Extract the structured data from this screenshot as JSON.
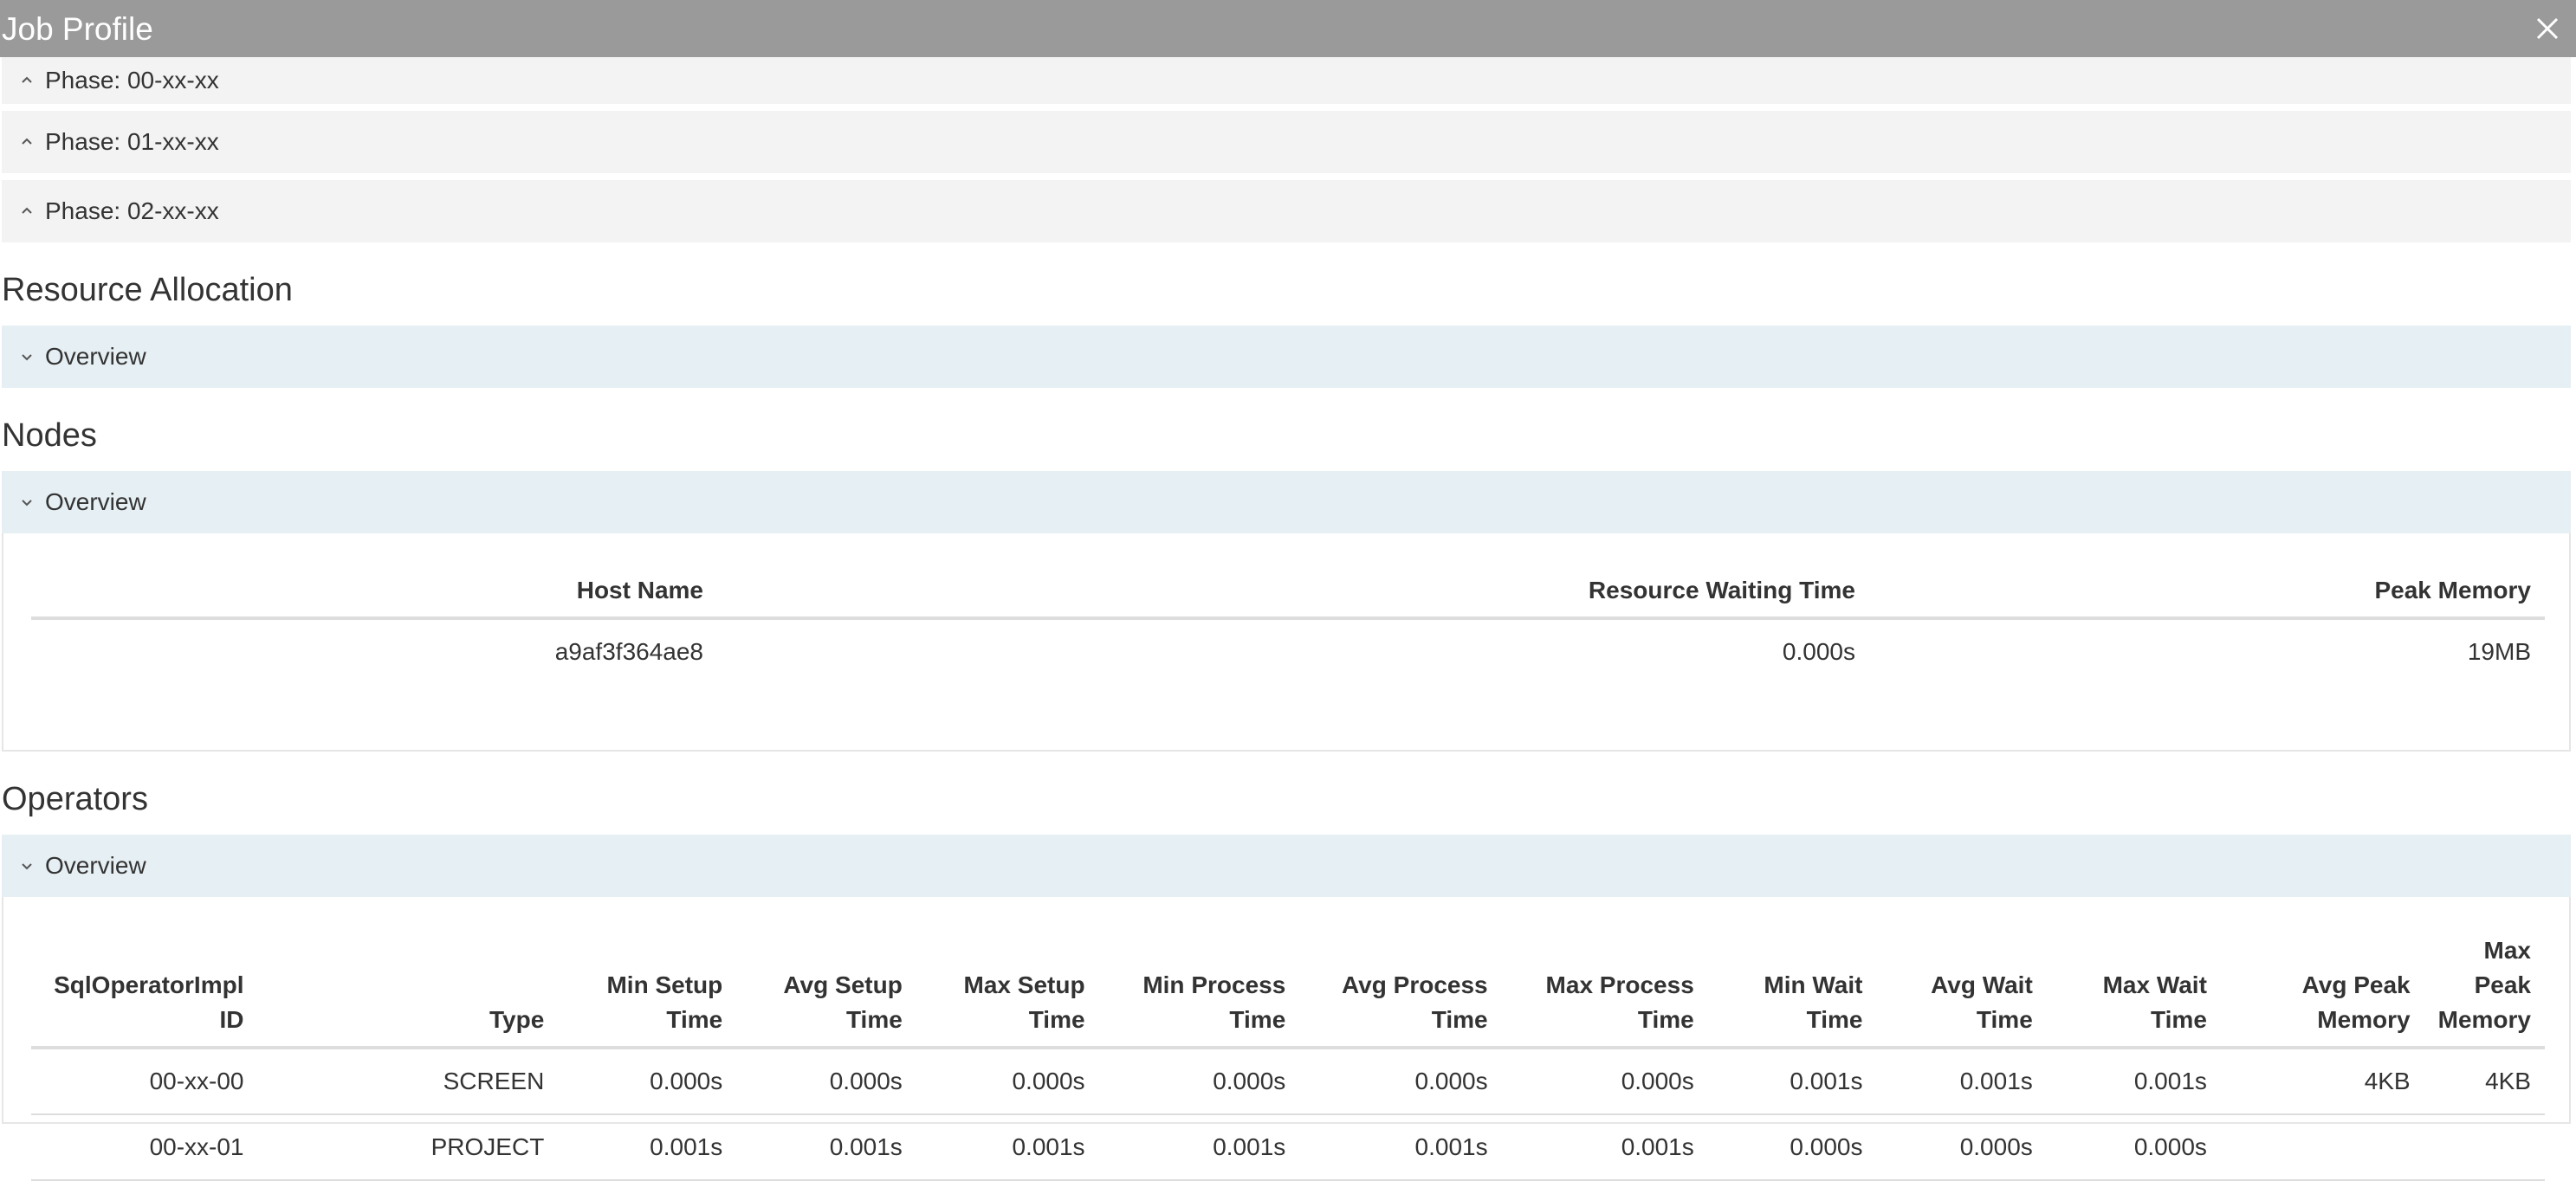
{
  "window": {
    "title": "Job Profile"
  },
  "phases": [
    {
      "label": "Phase: 00-xx-xx"
    },
    {
      "label": "Phase: 01-xx-xx"
    },
    {
      "label": "Phase: 02-xx-xx"
    }
  ],
  "resource_allocation": {
    "title": "Resource Allocation",
    "panel_label": "Overview"
  },
  "nodes": {
    "title": "Nodes",
    "panel_label": "Overview",
    "columns": [
      "Host Name",
      "Resource Waiting Time",
      "Peak Memory"
    ],
    "rows": [
      [
        "a9af3f364ae8",
        "0.000s",
        "19MB"
      ]
    ]
  },
  "operators": {
    "title": "Operators",
    "panel_label": "Overview",
    "columns": [
      [
        "SqlOperatorImpl",
        "ID"
      ],
      [
        "",
        "Type"
      ],
      [
        "Min Setup",
        "Time"
      ],
      [
        "Avg Setup",
        "Time"
      ],
      [
        "Max Setup",
        "Time"
      ],
      [
        "Min Process",
        "Time"
      ],
      [
        "Avg Process",
        "Time"
      ],
      [
        "Max Process",
        "Time"
      ],
      [
        "Min Wait",
        "Time"
      ],
      [
        "Avg Wait",
        "Time"
      ],
      [
        "Max Wait",
        "Time"
      ],
      [
        "Avg Peak",
        "Memory"
      ],
      [
        "Max Peak",
        "Memory"
      ]
    ],
    "rows": [
      [
        "00-xx-00",
        "SCREEN",
        "0.000s",
        "0.000s",
        "0.000s",
        "0.000s",
        "0.000s",
        "0.000s",
        "0.001s",
        "0.001s",
        "0.001s",
        "4KB",
        "4KB"
      ],
      [
        "00-xx-01",
        "PROJECT",
        "0.001s",
        "0.001s",
        "0.001s",
        "0.001s",
        "0.001s",
        "0.001s",
        "0.000s",
        "0.000s",
        "0.000s",
        "",
        ""
      ]
    ]
  },
  "colors": {
    "titlebar": "#9a9a9a",
    "phase_header": "#f3f3f3",
    "overview_header": "#e6eff3"
  }
}
